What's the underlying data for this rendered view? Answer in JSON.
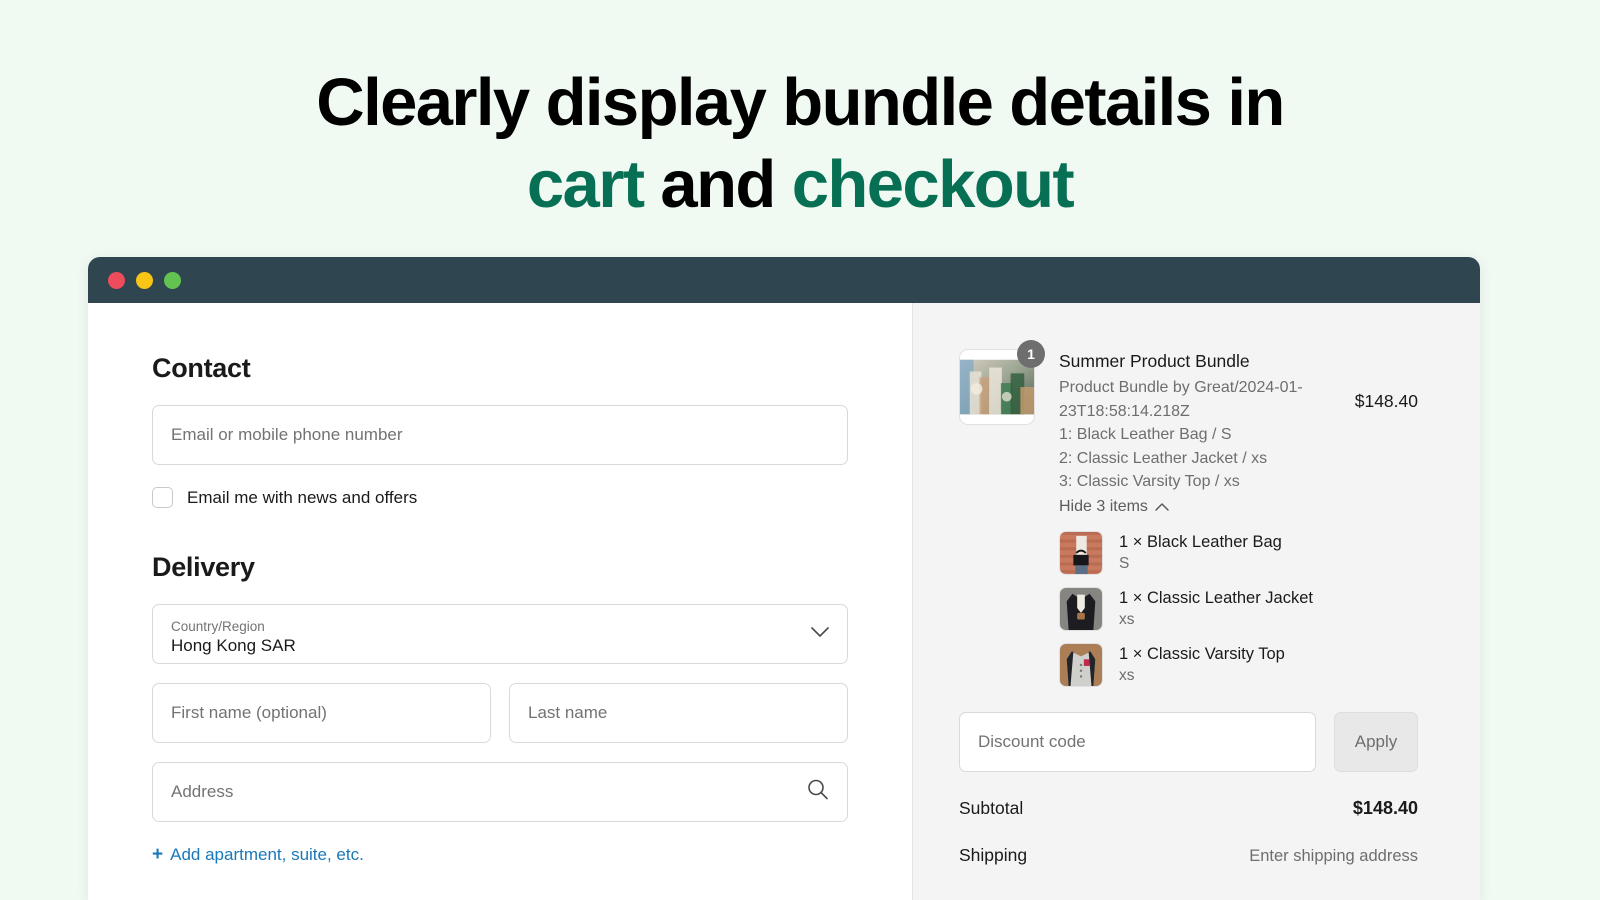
{
  "hero": {
    "line1": "Clearly display bundle details in",
    "line2_a": "cart",
    "line2_b": " and ",
    "line2_c": "checkout",
    "accent_color": "#077054"
  },
  "window": {
    "titlebar_color": "#2f4550",
    "dots": [
      "close-dot",
      "minimize-dot",
      "maximize-dot"
    ]
  },
  "checkout": {
    "contact": {
      "heading": "Contact",
      "email_placeholder": "Email or mobile phone number",
      "email_value": "",
      "newsletter_label": "Email me with news and offers",
      "newsletter_checked": false
    },
    "delivery": {
      "heading": "Delivery",
      "country_label": "Country/Region",
      "country_value": "Hong Kong SAR",
      "first_name_placeholder": "First name (optional)",
      "first_name_value": "",
      "last_name_placeholder": "Last name",
      "last_name_value": "",
      "address_placeholder": "Address",
      "address_value": "",
      "add_apartment_plus": "+",
      "add_apartment_label": "Add apartment, suite, etc.",
      "link_color": "#1878b9"
    }
  },
  "summary": {
    "bundle": {
      "title": "Summer Product Bundle",
      "quantity_badge": "1",
      "meta": "Product Bundle by Great/2024-01-23T18:58:14.218Z",
      "variants": [
        "1: Black Leather Bag / S",
        "2: Classic Leather Jacket / xs",
        "3: Classic Varsity Top / xs"
      ],
      "toggle_label": "Hide 3 items",
      "price": "$148.40"
    },
    "sub_items": [
      {
        "name": "1 × Black Leather Bag",
        "variant": "S"
      },
      {
        "name": "1 × Classic Leather Jacket",
        "variant": "xs"
      },
      {
        "name": "1 × Classic Varsity Top",
        "variant": "xs"
      }
    ],
    "discount": {
      "placeholder": "Discount code",
      "value": "",
      "apply_label": "Apply"
    },
    "totals": [
      {
        "label": "Subtotal",
        "value": "$148.40",
        "muted": false
      },
      {
        "label": "Shipping",
        "value": "Enter shipping address",
        "muted": true
      }
    ]
  }
}
